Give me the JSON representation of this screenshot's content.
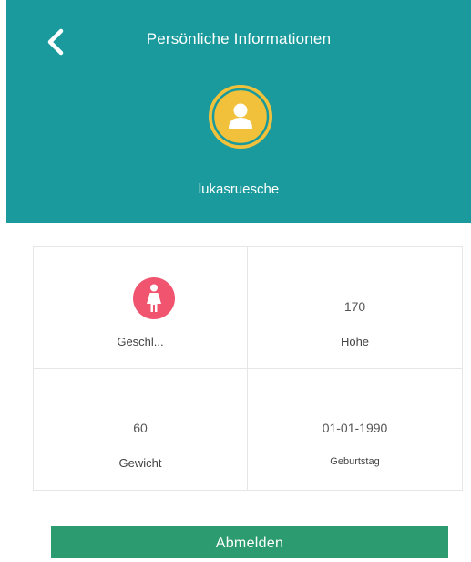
{
  "header": {
    "title": "Persönliche Informationen",
    "username": "lukasruesche",
    "background": "#1a9a9c",
    "back_icon": "chevron-left-icon",
    "avatar_icon": "user-avatar-icon",
    "avatar_color": "#f2c13b"
  },
  "profile": {
    "gender": {
      "label": "Geschl...",
      "icon": "female-icon",
      "icon_color": "#f0546f"
    },
    "height": {
      "value": "170",
      "label": "Höhe"
    },
    "weight": {
      "value": "60",
      "label": "Gewicht"
    },
    "birthday": {
      "value": "01-01-1990",
      "label": "Geburtstag"
    }
  },
  "actions": {
    "logout_label": "Abmelden",
    "logout_color": "#2c9b6f"
  }
}
